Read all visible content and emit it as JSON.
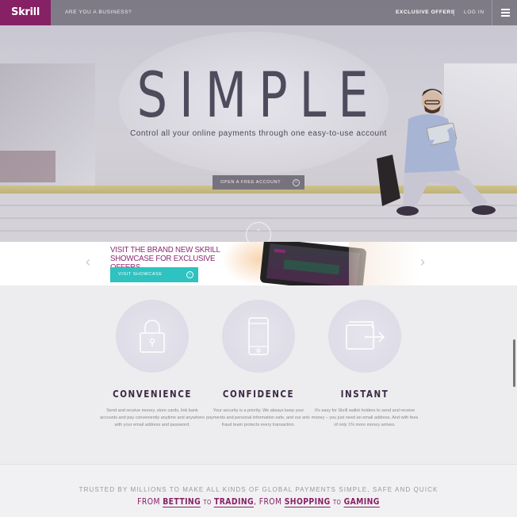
{
  "header": {
    "logo": "Skrill",
    "business_link": "ARE YOU A BUSINESS?",
    "offers_link": "EXCLUSIVE OFFERS",
    "login_link": "LOG IN"
  },
  "hero": {
    "title": "SIMPLE",
    "subtitle": "Control all your online payments through one easy-to-use account",
    "cta_label": "OPEN A FREE ACCOUNT"
  },
  "banner": {
    "title_line1": "VISIT THE BRAND NEW SKRILL",
    "title_line2": "SHOWCASE FOR EXCLUSIVE OFFERS",
    "button_label": "VISIT SHOWCASE"
  },
  "features": [
    {
      "icon": "lock-icon",
      "title": "CONVENIENCE",
      "text": "Send and receive money, store cards, link bank accounts and pay conveniently anytime and anywhere with your email address and password."
    },
    {
      "icon": "phone-icon",
      "title": "CONFIDENCE",
      "text": "Your security is a priority. We always keep your payments and personal information safe, and our anti-fraud team protects every transaction."
    },
    {
      "icon": "wallet-transfer-icon",
      "title": "INSTANT",
      "text": "It's easy for Skrill wallet holders to send and receive money – you just need an email address. And with fees of only 1% more money arrives."
    }
  ],
  "trust": {
    "line": "TRUSTED BY MILLIONS TO MAKE ALL KINDS OF GLOBAL PAYMENTS SIMPLE, SAFE AND QUICK",
    "from": "FROM",
    "betting": "BETTING",
    "to1": "TO",
    "trading": "TRADING",
    "from2": ", FROM",
    "shopping": "SHOPPING",
    "to2": "TO",
    "gaming": "GAMING"
  },
  "colors": {
    "brand": "#862165",
    "accent": "#2ec2c0",
    "header_bg": "#78747f"
  }
}
